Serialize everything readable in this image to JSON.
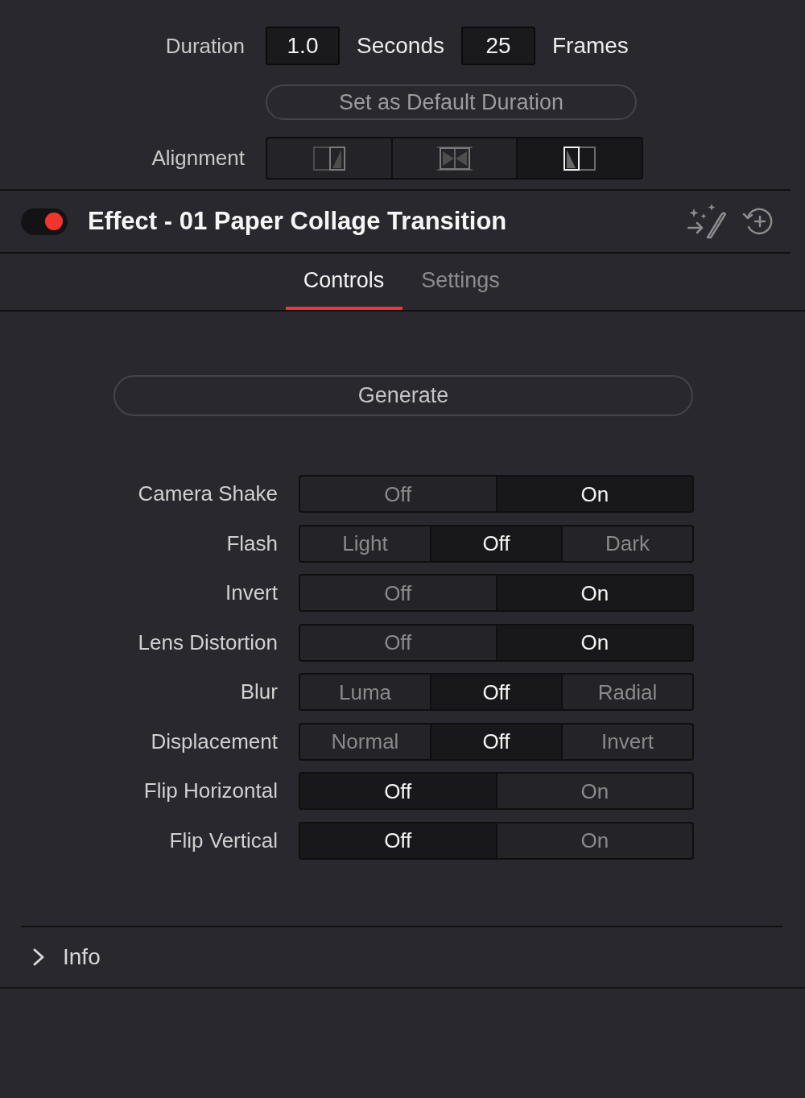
{
  "duration": {
    "label": "Duration",
    "seconds_value": "1.0",
    "seconds_label": "Seconds",
    "frames_value": "25",
    "frames_label": "Frames"
  },
  "default_button": "Set as Default Duration",
  "alignment": {
    "label": "Alignment",
    "options": [
      {
        "kind": "right",
        "selected": false
      },
      {
        "kind": "center",
        "selected": false
      },
      {
        "kind": "left",
        "selected": true
      }
    ]
  },
  "effect": {
    "enabled": true,
    "title": "Effect - 01 Paper Collage Transition"
  },
  "tabs": [
    {
      "label": "Controls",
      "selected": true
    },
    {
      "label": "Settings",
      "selected": false
    }
  ],
  "generate_button": "Generate",
  "controls": [
    {
      "label": "Camera Shake",
      "options": [
        {
          "label": "Off",
          "selected": false
        },
        {
          "label": "On",
          "selected": true
        }
      ]
    },
    {
      "label": "Flash",
      "options": [
        {
          "label": "Light",
          "selected": false
        },
        {
          "label": "Off",
          "selected": true
        },
        {
          "label": "Dark",
          "selected": false
        }
      ]
    },
    {
      "label": "Invert",
      "options": [
        {
          "label": "Off",
          "selected": false
        },
        {
          "label": "On",
          "selected": true
        }
      ]
    },
    {
      "label": "Lens Distortion",
      "options": [
        {
          "label": "Off",
          "selected": false
        },
        {
          "label": "On",
          "selected": true
        }
      ]
    },
    {
      "label": "Blur",
      "options": [
        {
          "label": "Luma",
          "selected": false
        },
        {
          "label": "Off",
          "selected": true
        },
        {
          "label": "Radial",
          "selected": false
        }
      ]
    },
    {
      "label": "Displacement",
      "options": [
        {
          "label": "Normal",
          "selected": false
        },
        {
          "label": "Off",
          "selected": true
        },
        {
          "label": "Invert",
          "selected": false
        }
      ]
    },
    {
      "label": "Flip Horizontal",
      "options": [
        {
          "label": "Off",
          "selected": true
        },
        {
          "label": "On",
          "selected": false
        }
      ]
    },
    {
      "label": "Flip Vertical",
      "options": [
        {
          "label": "Off",
          "selected": true
        },
        {
          "label": "On",
          "selected": false
        }
      ]
    }
  ],
  "info": {
    "label": "Info",
    "expanded": false
  }
}
